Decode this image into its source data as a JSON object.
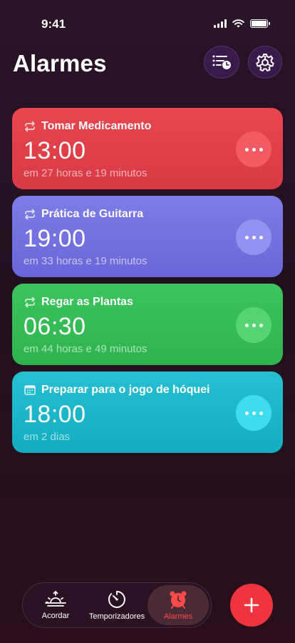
{
  "status_bar": {
    "time": "9:41"
  },
  "header": {
    "title": "Alarmes"
  },
  "alarms": [
    {
      "name": "Tomar Medicamento",
      "time": "13:00",
      "remaining": "em 27 horas e 19 minutos",
      "color": "#e9464f",
      "icon": "repeat-icon"
    },
    {
      "name": "Prática de Guitarra",
      "time": "19:00",
      "remaining": "em 33 horas e 19 minutos",
      "color": "#7e7ce6",
      "icon": "repeat-icon"
    },
    {
      "name": "Regar as Plantas",
      "time": "06:30",
      "remaining": "em 44 horas e 49 minutos",
      "color": "#3dc45e",
      "icon": "repeat-icon"
    },
    {
      "name": "Preparar para o jogo de hóquei",
      "time": "18:00",
      "remaining": "em 2 dias",
      "color": "#27c0d2",
      "icon": "calendar-icon"
    }
  ],
  "tabs": [
    {
      "label": "Acordar",
      "icon": "sunrise-icon",
      "active": false
    },
    {
      "label": "Temporizadores",
      "icon": "timer-icon",
      "active": false
    },
    {
      "label": "Alarmes",
      "icon": "alarm-clock-icon",
      "active": true
    }
  ],
  "accent_color": "#f0343f"
}
